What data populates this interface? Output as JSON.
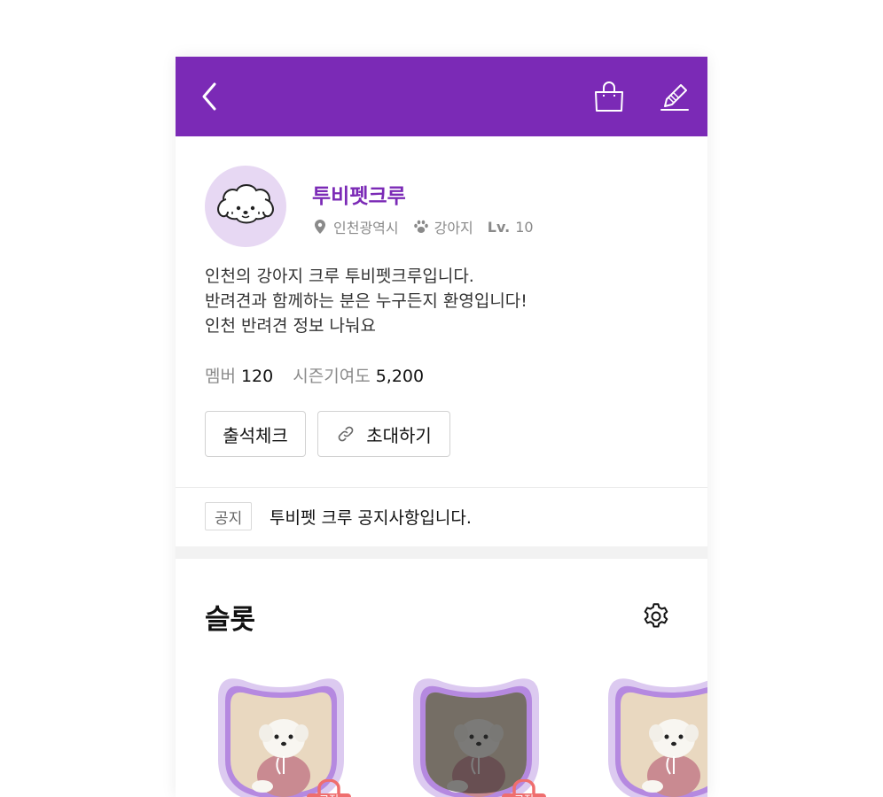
{
  "header": {
    "back_icon": "chevron-left-icon",
    "shop_icon": "shopping-bag-icon",
    "edit_icon": "pencil-icon",
    "bg_color": "#7b2ab6"
  },
  "crew": {
    "name": "투비펫크루",
    "location": "인천광역시",
    "category": "강아지",
    "level_label": "Lv.",
    "level": "10",
    "description": [
      "인천의 강아지 크루 투비펫크루입니다.",
      "반려견과 함께하는 분은 누구든지 환영입니다!",
      "인천 반려견 정보 나눠요"
    ],
    "stats": {
      "members_label": "멤버",
      "members": "120",
      "contribution_label": "시즌기여도",
      "contribution": "5,200"
    }
  },
  "actions": {
    "attend_label": "출석체크",
    "invite_label": "초대하기"
  },
  "notice": {
    "tag": "공지",
    "text": "투비펫 크루 공지사항입니다."
  },
  "slots": {
    "title": "슬롯",
    "settings_icon": "gear-icon",
    "items": [
      {
        "pin_label": "고정",
        "dimmed": false
      },
      {
        "pin_label": "고정",
        "dimmed": true
      },
      {
        "dimmed": false
      }
    ]
  },
  "colors": {
    "accent": "#7b2ab6",
    "avatar_bg": "#e7d8f3",
    "pin": "#ef6e6e",
    "slot_border": "#c79be6"
  }
}
